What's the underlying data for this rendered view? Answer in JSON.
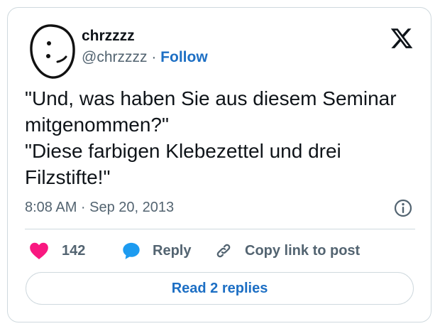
{
  "author": {
    "display_name": "chrzzzz",
    "handle": "@chrzzzz",
    "separator": " · ",
    "follow_label": "Follow"
  },
  "tweet": {
    "text": "\"Und, was haben Sie aus diesem Seminar mitgenommen?\"\n\"Diese farbigen Klebezettel und drei Filzstifte!\"",
    "timestamp": "8:08 AM · Sep 20, 2013"
  },
  "actions": {
    "like_count": "142",
    "reply_label": "Reply",
    "copy_link_label": "Copy link to post"
  },
  "read_replies_label": "Read 2 replies",
  "icons": {
    "avatar": "avatar-doodle-face",
    "brand": "x-logo-icon",
    "info": "info-icon",
    "like": "heart-icon",
    "reply": "speech-bubble-icon",
    "copy": "link-icon"
  },
  "colors": {
    "like": "#f91880",
    "reply": "#1d9bf0",
    "link_text": "#1d6fc4",
    "secondary_text": "#536471",
    "border": "#cfd9de"
  }
}
